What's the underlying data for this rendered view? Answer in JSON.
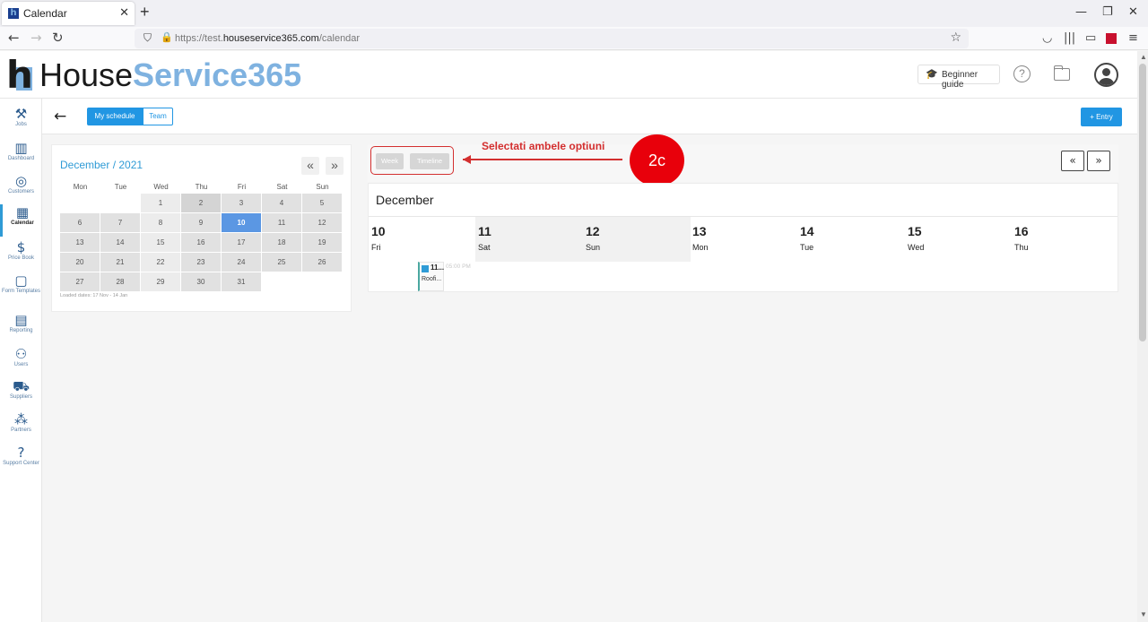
{
  "browser": {
    "tab_title": "Calendar",
    "tab_close": "✕",
    "new_tab": "+",
    "url_prefix": "https://test.",
    "url_host": "houseservice365.com",
    "url_path": "/calendar",
    "win_min": "—",
    "win_restore": "❐",
    "win_close": "✕"
  },
  "header": {
    "logo_house": "House",
    "logo_service": "Service365",
    "guide_label": "Beginner guide",
    "help_glyph": "?"
  },
  "sidebar": {
    "items": [
      {
        "label": "Jobs",
        "icon": "tools-icon",
        "glyph": "⚒"
      },
      {
        "label": "Dashboard",
        "icon": "chart-icon",
        "glyph": "▥"
      },
      {
        "label": "Customers",
        "icon": "target-icon",
        "glyph": "◎"
      },
      {
        "label": "Calendar",
        "icon": "calendar-icon",
        "glyph": "▦"
      },
      {
        "label": "Price Book",
        "icon": "price-icon",
        "glyph": "$"
      },
      {
        "label": "Form Templates",
        "icon": "form-icon",
        "glyph": "▢"
      },
      {
        "label": "Reporting",
        "icon": "report-icon",
        "glyph": "▤"
      },
      {
        "label": "Users",
        "icon": "users-icon",
        "glyph": "⚇"
      },
      {
        "label": "Suppliers",
        "icon": "truck-icon",
        "glyph": "⛟"
      },
      {
        "label": "Partners",
        "icon": "partners-icon",
        "glyph": "⁂"
      },
      {
        "label": "Support Center",
        "icon": "support-icon",
        "glyph": "?"
      }
    ]
  },
  "subbar": {
    "back_glyph": "←",
    "my_schedule": "My schedule",
    "team": "Team",
    "entry": "+ Entry"
  },
  "mini_calendar": {
    "title": "December / 2021",
    "prev": "«",
    "next": "»",
    "weekdays": [
      "Mon",
      "Tue",
      "Wed",
      "Thu",
      "Fri",
      "Sat",
      "Sun"
    ],
    "days": [
      "",
      "",
      "1",
      "2",
      "3",
      "4",
      "5",
      "6",
      "7",
      "8",
      "9",
      "10",
      "11",
      "12",
      "13",
      "14",
      "15",
      "16",
      "17",
      "18",
      "19",
      "20",
      "21",
      "22",
      "23",
      "24",
      "25",
      "26",
      "27",
      "28",
      "29",
      "30",
      "31"
    ],
    "today": "10",
    "loaded": "Loaded dates: 17 Nov - 14 Jan"
  },
  "calendar": {
    "view_week": "Week",
    "view_timeline": "Timeline",
    "prev": "«",
    "next": "»",
    "month": "December",
    "days": [
      {
        "num": "10",
        "name": "Fri"
      },
      {
        "num": "11",
        "name": "Sat"
      },
      {
        "num": "12",
        "name": "Sun"
      },
      {
        "num": "13",
        "name": "Mon"
      },
      {
        "num": "14",
        "name": "Tue"
      },
      {
        "num": "15",
        "name": "Wed"
      },
      {
        "num": "16",
        "name": "Thu"
      }
    ],
    "event_title": "11...",
    "event_name": "Roofi...",
    "event_time": "05:00 PM"
  },
  "annotation": {
    "text": "Selectati ambele optiuni",
    "badge": "2c"
  },
  "colors": {
    "accent": "#2196e3",
    "annotation": "#d32f2f",
    "logo_blue": "#7fb2e0"
  }
}
